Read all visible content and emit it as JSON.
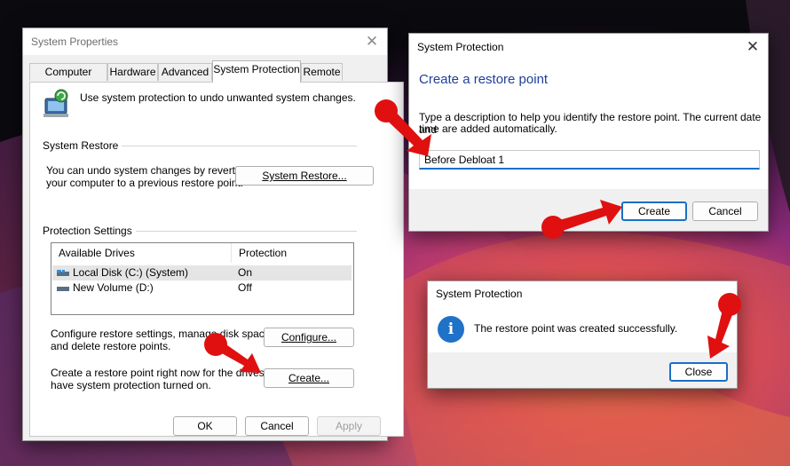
{
  "sysprops": {
    "title": "System Properties",
    "tabs": [
      "Computer Name",
      "Hardware",
      "Advanced",
      "System Protection",
      "Remote"
    ],
    "intro": "Use system protection to undo unwanted system changes.",
    "restore_group": "System Restore",
    "restore_text_1": "You can undo system changes by reverting",
    "restore_text_2": "your computer to a previous restore point.",
    "system_restore_btn": "System Restore...",
    "protection_group": "Protection Settings",
    "col_drives": "Available Drives",
    "col_protection": "Protection",
    "drives": [
      {
        "name": "Local Disk (C:) (System)",
        "protection": "On"
      },
      {
        "name": "New Volume (D:)",
        "protection": "Off"
      }
    ],
    "configure_text_1": "Configure restore settings, manage disk space,",
    "configure_text_2": "and delete restore points.",
    "configure_btn": "Configure...",
    "create_text_1": "Create a restore point right now for the drives that",
    "create_text_2": "have system protection turned on.",
    "create_btn": "Create...",
    "ok_btn": "OK",
    "cancel_btn": "Cancel",
    "apply_btn": "Apply"
  },
  "create_dialog": {
    "title": "System Protection",
    "heading": "Create a restore point",
    "desc_1": "Type a description to help you identify the restore point. The current date and",
    "desc_2": "time are added automatically.",
    "input_value": "Before Debloat 1",
    "create_btn": "Create",
    "cancel_btn": "Cancel"
  },
  "success_dialog": {
    "title": "System Protection",
    "message": "The restore point was created successfully.",
    "info_glyph": "i",
    "close_btn": "Close"
  },
  "icons": {
    "close_glyph": "✕"
  },
  "colors": {
    "accent": "#1a6fc5",
    "heading": "#1f3f9a",
    "marker": "#e01010"
  }
}
